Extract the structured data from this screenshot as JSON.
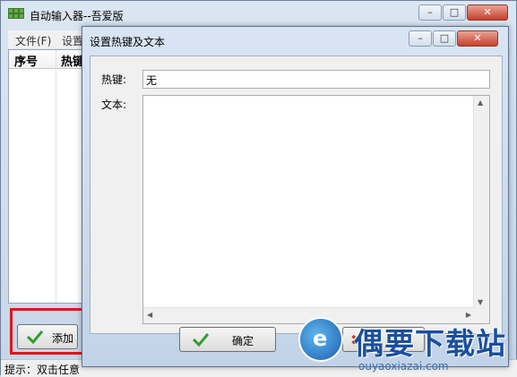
{
  "main_window": {
    "title": "自动输入器--吾爱版",
    "controls": {
      "minimize": "–",
      "maximize": "□",
      "close": "✕"
    },
    "menu": [
      "文件(F)",
      "设置"
    ],
    "list": {
      "columns": [
        "序号",
        "热键"
      ]
    },
    "add_button": {
      "label": "添加",
      "icon": "check-icon"
    },
    "status_text": "提示：双击任意"
  },
  "dialog": {
    "title": "设置热键及文本",
    "controls": {
      "minimize": "–",
      "maximize": "□",
      "close": "✕"
    },
    "hotkey": {
      "label": "热键:",
      "value": "无"
    },
    "text": {
      "label": "文本:",
      "value": ""
    },
    "ok_button": {
      "label": "确定",
      "icon": "check-icon"
    },
    "cancel_button": {
      "icon": "x-icon"
    }
  },
  "watermark": {
    "text": "偶要下载站",
    "url": "ouyaoxiazai.com"
  },
  "colors": {
    "highlight_frame": "#e2141b",
    "check_green": "#2e9e2e"
  }
}
